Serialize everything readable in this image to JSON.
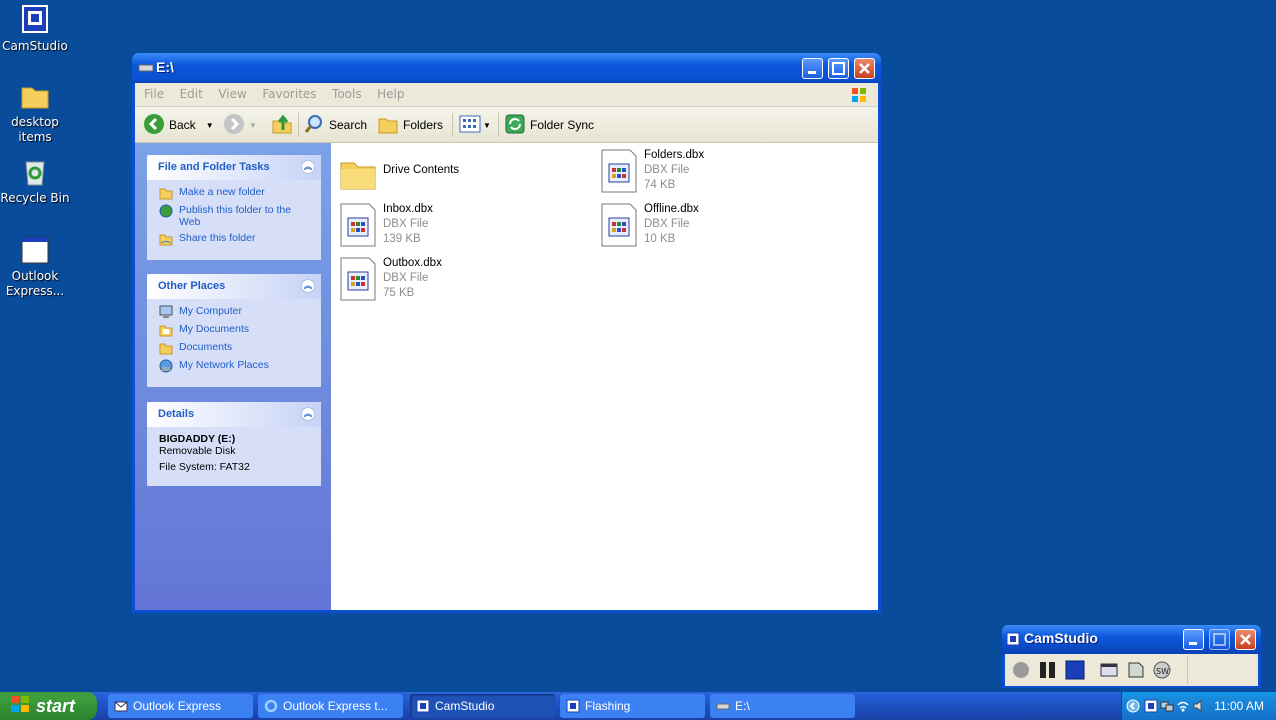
{
  "desktop": {
    "icons": [
      {
        "label": "CamStudio"
      },
      {
        "label": "desktop items"
      },
      {
        "label": "Recycle Bin"
      },
      {
        "label": "Outlook Express..."
      }
    ]
  },
  "explorer": {
    "title": "E:\\",
    "menu": [
      "File",
      "Edit",
      "View",
      "Favorites",
      "Tools",
      "Help"
    ],
    "toolbar": {
      "back_label": "Back",
      "search_label": "Search",
      "folders_label": "Folders",
      "folder_sync_label": "Folder Sync"
    },
    "tasks_panel": {
      "title": "File and Folder Tasks",
      "links": [
        "Make a new folder",
        "Publish this folder to the Web",
        "Share this folder"
      ]
    },
    "places_panel": {
      "title": "Other Places",
      "links": [
        "My Computer",
        "My Documents",
        "Documents",
        "My Network Places"
      ]
    },
    "details_panel": {
      "title": "Details",
      "name": "BIGDADDY (E:)",
      "type": "Removable Disk",
      "fs": "File System: FAT32"
    },
    "files": [
      {
        "name": "Drive Contents",
        "type": "",
        "size": ""
      },
      {
        "name": "Folders.dbx",
        "type": "DBX File",
        "size": "74 KB"
      },
      {
        "name": "Inbox.dbx",
        "type": "DBX File",
        "size": "139 KB"
      },
      {
        "name": "Offline.dbx",
        "type": "DBX File",
        "size": "10 KB"
      },
      {
        "name": "Outbox.dbx",
        "type": "DBX File",
        "size": "75 KB"
      }
    ]
  },
  "camstudio": {
    "title": "CamStudio"
  },
  "taskbar": {
    "start_label": "start",
    "tasks": [
      "Outlook Express",
      "Outlook Express t...",
      "CamStudio",
      "Flashing",
      "E:\\"
    ],
    "clock": "11:00 AM"
  }
}
